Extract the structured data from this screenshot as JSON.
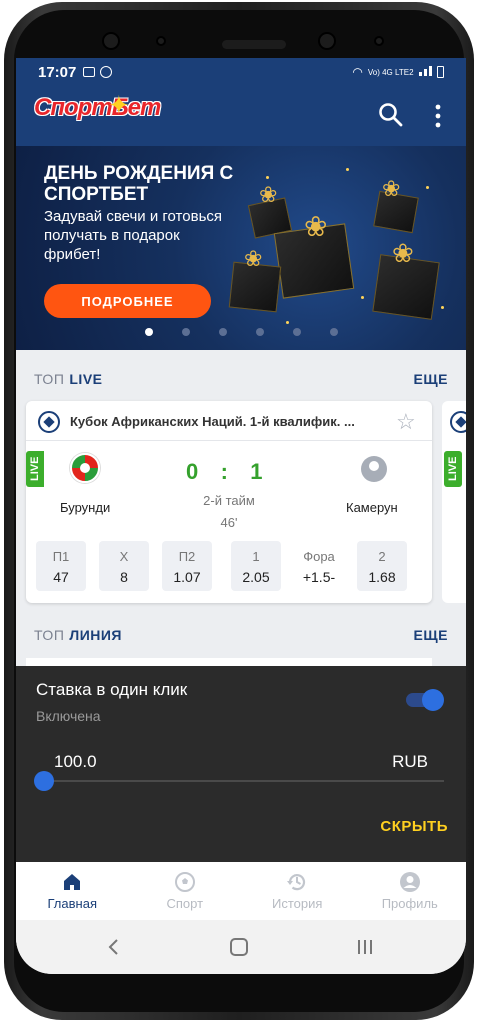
{
  "status_bar": {
    "time": "17:07",
    "network": "Vo) 4G LTE2"
  },
  "app": {
    "logo": "СпортБет"
  },
  "banner": {
    "title": "ДЕНЬ РОЖДЕНИЯ С СПОРТБЕТ",
    "subtitle": "Задувай свечи и готовься получать в подарок фрибет!",
    "button": "ПОДРОБНЕЕ",
    "slides_count": 6,
    "active_slide": 1
  },
  "top_live": {
    "label_prefix": "ТОП",
    "label": "LIVE",
    "more": "ЕЩЕ",
    "match": {
      "league": "Кубок Африканских Наций. 1-й квалифик. ...",
      "live_badge": "LIVE",
      "home": "Бурунди",
      "away": "Камерун",
      "score_home": "0",
      "score_sep": ":",
      "score_away": "1",
      "period": "2-й тайм",
      "minute": "46'",
      "odds": [
        {
          "label": "П1",
          "value": "47"
        },
        {
          "label": "X",
          "value": "8"
        },
        {
          "label": "П2",
          "value": "1.07"
        },
        {
          "label": "1",
          "value": "2.05"
        },
        {
          "label": "Фора",
          "value": "+1.5-"
        },
        {
          "label": "2",
          "value": "1.68"
        }
      ]
    }
  },
  "top_line": {
    "label_prefix": "ТОП",
    "label": "ЛИНИЯ",
    "more": "ЕЩЕ"
  },
  "one_click": {
    "title": "Ставка в один клик",
    "state": "Включена",
    "enabled": true,
    "amount": "100.0",
    "currency": "RUB",
    "hide": "СКРЫТЬ"
  },
  "bottom_nav": [
    {
      "label": "Главная",
      "icon": "home-icon",
      "active": true
    },
    {
      "label": "Спорт",
      "icon": "ball-icon",
      "active": false
    },
    {
      "label": "История",
      "icon": "history-icon",
      "active": false
    },
    {
      "label": "Профиль",
      "icon": "profile-icon",
      "active": false
    }
  ],
  "colors": {
    "brand": "#1b3f78",
    "accent": "#ff5511",
    "live": "#3cae2c",
    "hide": "#ffd020"
  }
}
